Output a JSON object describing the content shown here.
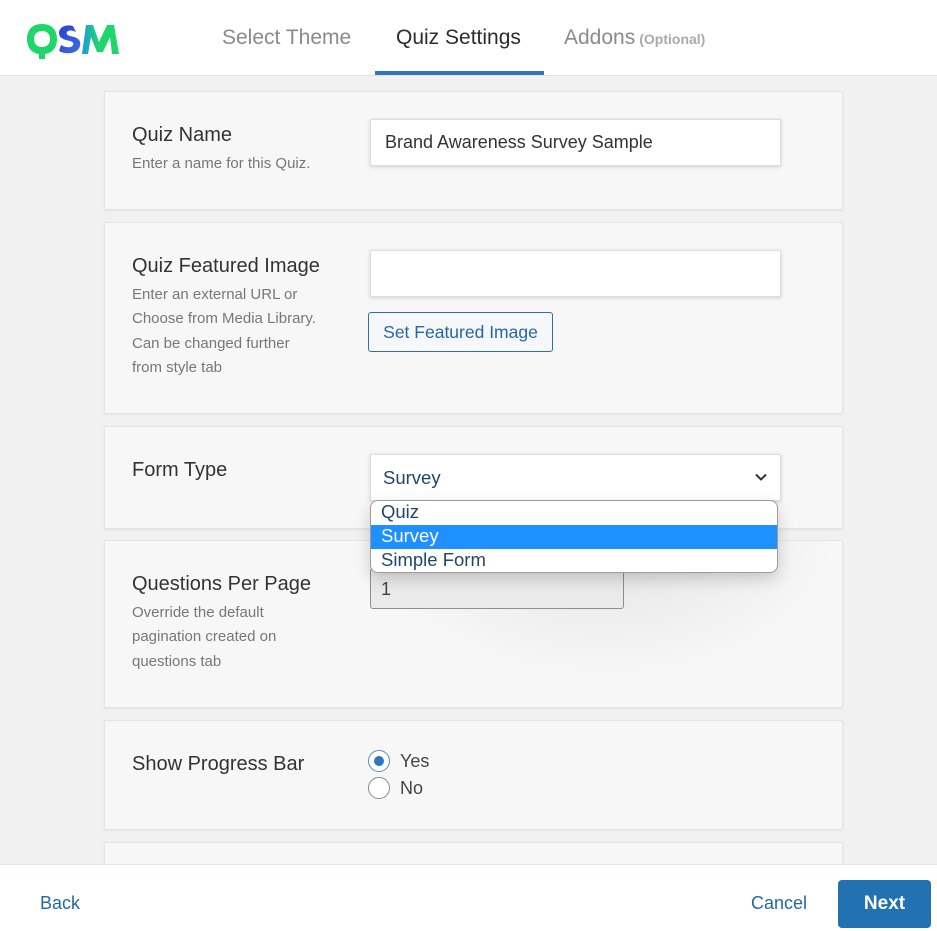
{
  "brand": {
    "logo_text": "QSM",
    "colors": {
      "green": "#1fd66b",
      "blue": "#3a4fd0",
      "cyan": "#1aa0e0"
    }
  },
  "tabs": [
    {
      "label": "Select Theme",
      "active": false
    },
    {
      "label": "Quiz Settings",
      "active": true
    },
    {
      "label": "Addons",
      "suffix": "(Optional)",
      "active": false
    }
  ],
  "quiz_name": {
    "label": "Quiz Name",
    "description": "Enter a name for this Quiz.",
    "value": "Brand Awareness Survey Sample"
  },
  "featured_image": {
    "label": "Quiz Featured Image",
    "description_lines": [
      "Enter an external URL or",
      "Choose from Media Library.",
      "Can be changed further",
      "from style tab"
    ],
    "value": "",
    "button_label": "Set Featured Image"
  },
  "form_type": {
    "label": "Form Type",
    "selected": "Survey",
    "options": [
      {
        "label": "Quiz",
        "selected": false
      },
      {
        "label": "Survey",
        "selected": true
      },
      {
        "label": "Simple Form",
        "selected": false
      }
    ]
  },
  "questions_per_page": {
    "label": "Questions Per Page",
    "description_lines": [
      "Override the default",
      "pagination created on",
      "questions tab"
    ],
    "value": "1"
  },
  "progress_bar": {
    "label": "Show Progress Bar",
    "options": [
      {
        "label": "Yes",
        "checked": true
      },
      {
        "label": "No",
        "checked": false
      }
    ]
  },
  "footer": {
    "back_label": "Back",
    "cancel_label": "Cancel",
    "next_label": "Next"
  },
  "accent_color": "#2271b1"
}
